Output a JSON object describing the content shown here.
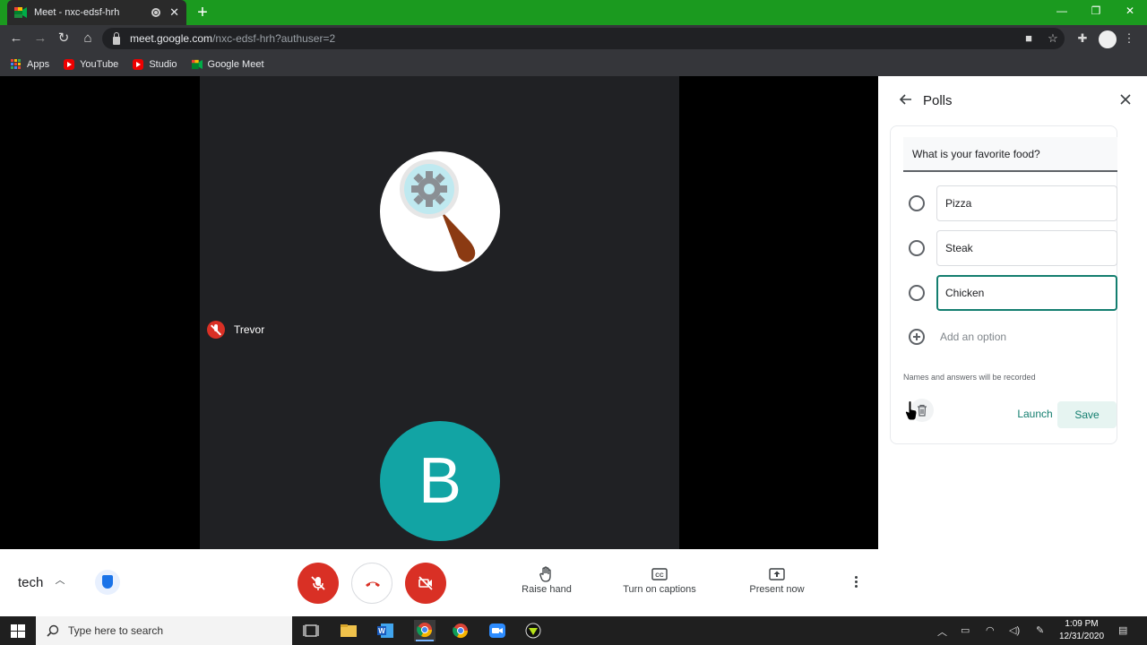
{
  "browser": {
    "tab_title": "Meet - nxc-edsf-hrh",
    "url_host": "meet.google.com",
    "url_path": "/nxc-edsf-hrh?authuser=2",
    "bookmarks": [
      {
        "label": "Apps",
        "icon": "apps-grid-icon"
      },
      {
        "label": "YouTube",
        "icon": "youtube-icon"
      },
      {
        "label": "Studio",
        "icon": "youtube-studio-icon"
      },
      {
        "label": "Google Meet",
        "icon": "google-meet-icon"
      }
    ]
  },
  "meeting": {
    "participant_name": "Trevor",
    "self_initial": "B",
    "meeting_name": "tech"
  },
  "controls": {
    "raise_hand": "Raise hand",
    "captions": "Turn on captions",
    "present": "Present now"
  },
  "polls": {
    "title": "Polls",
    "question": "What is your favorite food?",
    "options": [
      "Pizza",
      "Steak",
      "Chicken"
    ],
    "add_option": "Add an option",
    "note": "Names and answers will be recorded",
    "launch": "Launch",
    "save": "Save"
  },
  "taskbar": {
    "search_placeholder": "Type here to search",
    "time": "1:09 PM",
    "date": "12/31/2020"
  },
  "colors": {
    "tab_strip": "#1b9a1f",
    "accent": "#137e6f",
    "danger": "#d93025",
    "self_avatar": "#12a4a4"
  }
}
